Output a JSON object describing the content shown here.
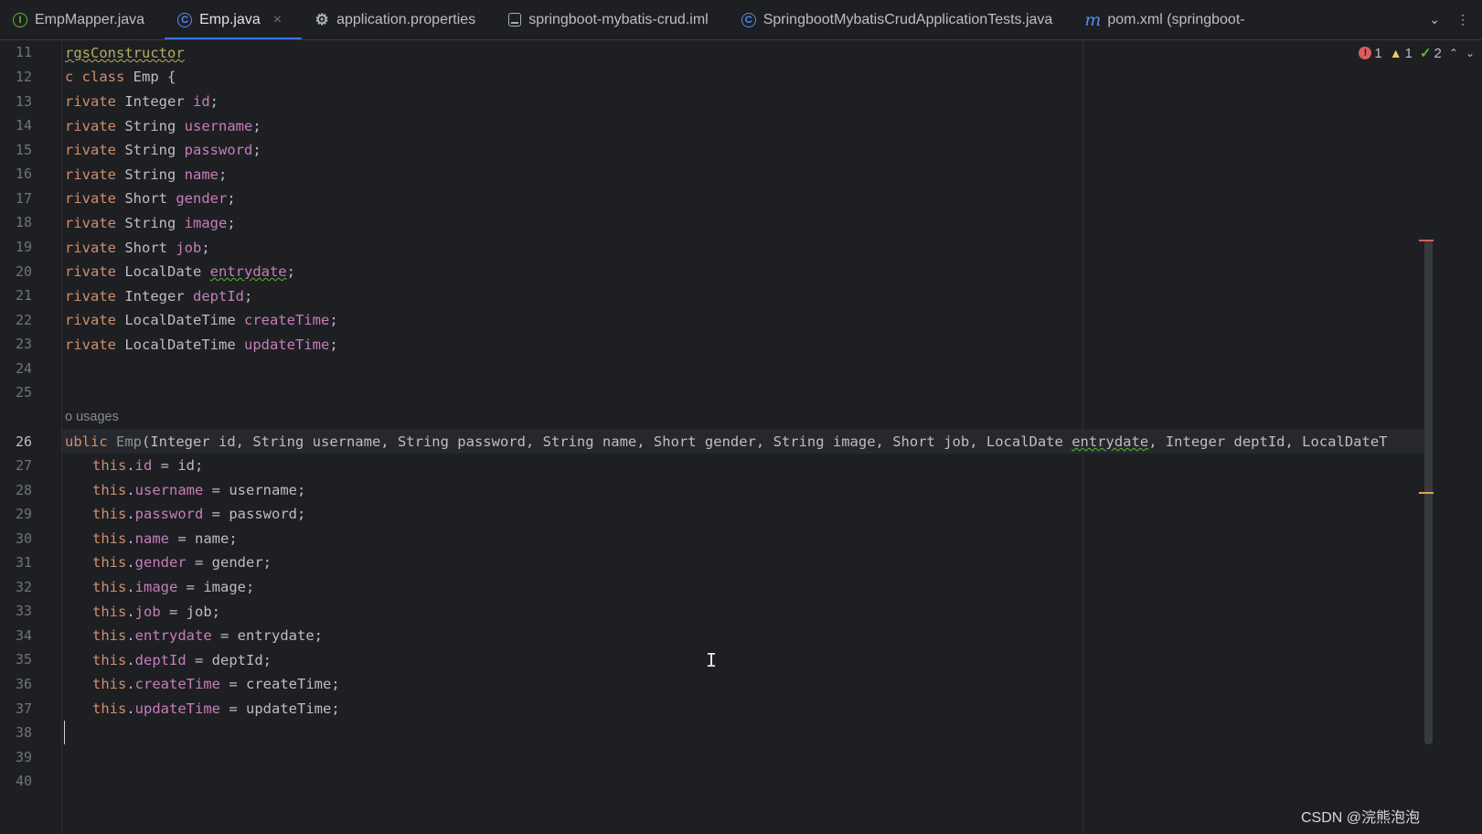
{
  "tabs": [
    {
      "label": "EmpMapper.java",
      "icon": "interface-icon",
      "active": false
    },
    {
      "label": "Emp.java",
      "icon": "class-icon",
      "active": true,
      "close": "×"
    },
    {
      "label": "application.properties",
      "icon": "gear-icon",
      "active": false
    },
    {
      "label": "springboot-mybatis-crud.iml",
      "icon": "module-file-icon",
      "active": false
    },
    {
      "label": "SpringbootMybatisCrudApplicationTests.java",
      "icon": "class-icon",
      "active": false
    },
    {
      "label": "pom.xml (springboot-",
      "icon": "maven-icon",
      "active": false
    }
  ],
  "tab_glyphs": {
    "interface": "I",
    "class": "C",
    "gear": "⚙",
    "maven": "m",
    "chevron_down": "⌄",
    "more": "⋮"
  },
  "inspections": {
    "errors": "1",
    "warnings": "1",
    "ok": "2",
    "error_glyph": "!",
    "warn_glyph": "▲",
    "ok_glyph": "✓",
    "up": "⌃",
    "down": "⌄"
  },
  "line_numbers": [
    "11",
    "12",
    "13",
    "14",
    "15",
    "16",
    "17",
    "18",
    "19",
    "20",
    "21",
    "22",
    "23",
    "24",
    "25",
    "26",
    "27",
    "28",
    "29",
    "30",
    "31",
    "32",
    "33",
    "34",
    "35",
    "36",
    "37",
    "38",
    "39",
    "40"
  ],
  "current_line": "26",
  "code": {
    "l11": "rgsConstructor",
    "l12_kw": "c class",
    "l12_rest": " Emp {",
    "fields": [
      {
        "kw": "rivate",
        "type": " Integer ",
        "name": "id"
      },
      {
        "kw": "rivate",
        "type": " String ",
        "name": "username"
      },
      {
        "kw": "rivate",
        "type": " String ",
        "name": "password"
      },
      {
        "kw": "rivate",
        "type": " String ",
        "name": "name"
      },
      {
        "kw": "rivate",
        "type": " Short ",
        "name": "gender"
      },
      {
        "kw": "rivate",
        "type": " String ",
        "name": "image"
      },
      {
        "kw": "rivate",
        "type": " Short ",
        "name": "job"
      },
      {
        "kw": "rivate",
        "type": " LocalDate ",
        "name": "entrydate"
      },
      {
        "kw": "rivate",
        "type": " Integer ",
        "name": "deptId"
      },
      {
        "kw": "rivate",
        "type": " LocalDateTime ",
        "name": "createTime"
      },
      {
        "kw": "rivate",
        "type": " LocalDateTime ",
        "name": "updateTime"
      }
    ],
    "usages_hint": "o usages",
    "ctor_kw": "ublic",
    "ctor_name": "Emp",
    "ctor_params_a": "(Integer id, String username, String password, String name, Short gender, String image, Short job, LocalDate ",
    "ctor_params_warn": "entrydate",
    "ctor_params_b": ", Integer deptId, LocalDateT",
    "assignments": [
      {
        "field": "id",
        "value": "id"
      },
      {
        "field": "username",
        "value": "username"
      },
      {
        "field": "password",
        "value": "password"
      },
      {
        "field": "name",
        "value": "name"
      },
      {
        "field": "gender",
        "value": "gender"
      },
      {
        "field": "image",
        "value": "image"
      },
      {
        "field": "job",
        "value": "job"
      },
      {
        "field": "entrydate",
        "value": "entrydate"
      },
      {
        "field": "deptId",
        "value": "deptId"
      },
      {
        "field": "createTime",
        "value": "createTime"
      },
      {
        "field": "updateTime",
        "value": "updateTime"
      }
    ],
    "this_kw": "this",
    "semicolon": ";"
  },
  "text_cursor_glyph": "I",
  "watermark": "CSDN @浣熊泡泡",
  "colors": {
    "keyword": "#cf8e6d",
    "field": "#c77dbb",
    "annotation": "#b3ae60",
    "accent": "#3574f0",
    "error": "#db5c5c",
    "warning": "#e0a63b"
  }
}
